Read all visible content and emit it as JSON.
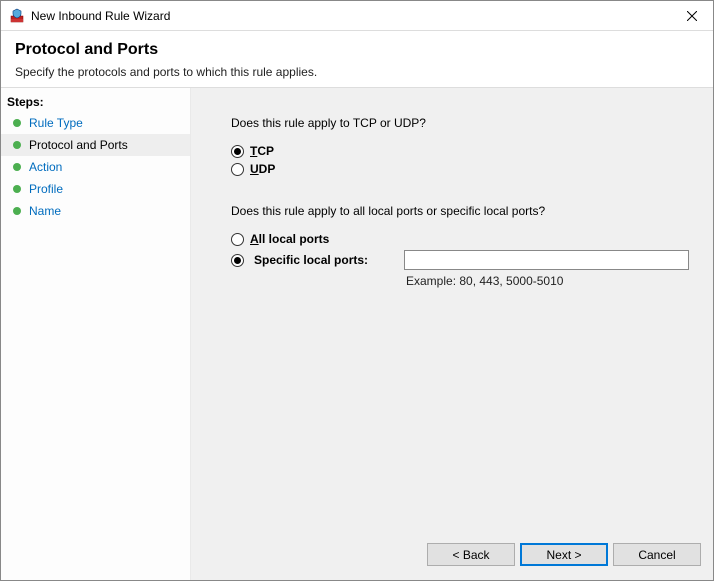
{
  "window": {
    "title": "New Inbound Rule Wizard"
  },
  "header": {
    "title": "Protocol and Ports",
    "subtitle": "Specify the protocols and ports to which this rule applies."
  },
  "sidebar": {
    "title": "Steps:",
    "items": [
      {
        "label": "Rule Type",
        "active": false
      },
      {
        "label": "Protocol and Ports",
        "active": true
      },
      {
        "label": "Action",
        "active": false
      },
      {
        "label": "Profile",
        "active": false
      },
      {
        "label": "Name",
        "active": false
      }
    ]
  },
  "content": {
    "protocol_question": "Does this rule apply to TCP or UDP?",
    "protocol_options": {
      "tcp": {
        "letter": "T",
        "rest": "CP",
        "selected": true
      },
      "udp": {
        "letter": "U",
        "rest": "DP",
        "selected": false
      }
    },
    "ports_question": "Does this rule apply to all local ports or specific local ports?",
    "ports_options": {
      "all": {
        "letter": "A",
        "rest": "ll local ports",
        "selected": false
      },
      "specific": {
        "label": "Specific local ports:",
        "selected": true
      }
    },
    "port_value": "",
    "example_text": "Example: 80, 443, 5000-5010"
  },
  "buttons": {
    "back": "< Back",
    "next": "Next >",
    "cancel": "Cancel"
  }
}
